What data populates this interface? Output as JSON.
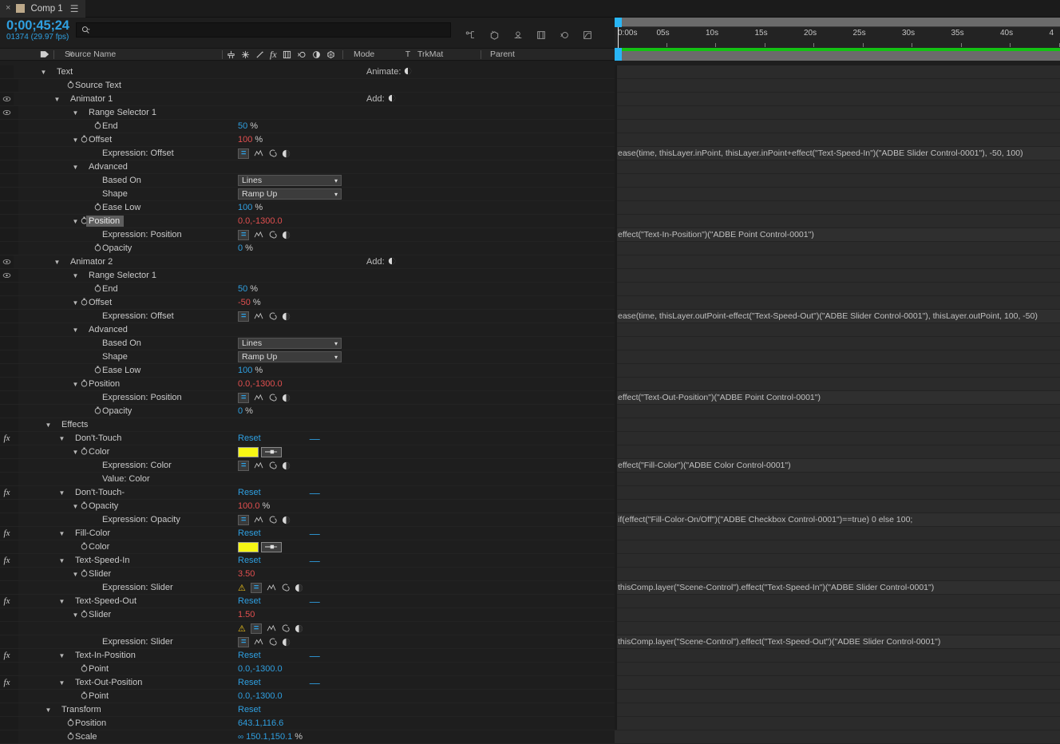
{
  "tab": {
    "close": "×",
    "label": "Comp 1",
    "menu": "☰"
  },
  "timecode": {
    "current": "0;00;45;24",
    "frames": "01374 (29.97 fps)"
  },
  "search": {
    "placeholder": "",
    "value": ""
  },
  "columns": {
    "source_name": "Source Name",
    "number": "#",
    "mode": "Mode",
    "t": "T",
    "trkmat": "TrkMat",
    "parent": "Parent"
  },
  "ruler": {
    "ticks": [
      "0:00s",
      "05s",
      "10s",
      "15s",
      "20s",
      "25s",
      "30s",
      "35s",
      "40s",
      "4"
    ],
    "render_bar_color": "#13c213",
    "playhead_color": "#29b6f6"
  },
  "colors": {
    "accent_blue": "#2f9fe0",
    "value_red": "#e04f4f",
    "swatch_yellow": "#f6f615",
    "warning_yellow": "#f2c61c"
  },
  "rows": [
    {
      "indent": 1,
      "twirl": "▼",
      "label": "Text",
      "kind": "group",
      "add": "Animate:",
      "clipped": true
    },
    {
      "indent": 2,
      "stopwatch": true,
      "label": "Source Text",
      "kind": "prop"
    },
    {
      "indent": 2,
      "twirl": "▼",
      "label": "Animator 1",
      "kind": "group",
      "add": "Add:",
      "eye": true
    },
    {
      "indent": 3,
      "twirl": "▼",
      "label": "Range Selector 1",
      "kind": "group",
      "eye": true
    },
    {
      "indent": 4,
      "stopwatch": true,
      "label": "End",
      "kind": "prop",
      "value": "50",
      "value_color": "blue",
      "unit": "%"
    },
    {
      "indent": 3,
      "twirl": "▼",
      "stopwatch": true,
      "label": "Offset",
      "kind": "prop",
      "value": "100",
      "value_color": "red",
      "unit": "%"
    },
    {
      "indent": 4,
      "label": "Expression: Offset",
      "kind": "expr",
      "expression": "ease(time, thisLayer.inPoint, thisLayer.inPoint+effect(\"Text-Speed-In\")(\"ADBE Slider Control-0001\"), -50, 100)"
    },
    {
      "indent": 3,
      "twirl": "▼",
      "label": "Advanced",
      "kind": "group"
    },
    {
      "indent": 4,
      "label": "Based On",
      "kind": "dropdown",
      "dropdown": "Lines"
    },
    {
      "indent": 4,
      "label": "Shape",
      "kind": "dropdown",
      "dropdown": "Ramp Up"
    },
    {
      "indent": 4,
      "stopwatch": true,
      "label": "Ease Low",
      "kind": "prop",
      "value": "100",
      "value_color": "blue",
      "unit": "%"
    },
    {
      "indent": 3,
      "twirl": "▼",
      "stopwatch": true,
      "label": "Position",
      "kind": "prop",
      "value": "0.0,-1300.0",
      "value_color": "red",
      "selected": true
    },
    {
      "indent": 4,
      "label": "Expression: Position",
      "kind": "expr",
      "expression": "effect(\"Text-In-Position\")(\"ADBE Point Control-0001\")"
    },
    {
      "indent": 4,
      "stopwatch": true,
      "label": "Opacity",
      "kind": "prop",
      "value": "0",
      "value_color": "blue",
      "unit": "%"
    },
    {
      "indent": 2,
      "twirl": "▼",
      "label": "Animator 2",
      "kind": "group",
      "add": "Add:",
      "eye": true
    },
    {
      "indent": 3,
      "twirl": "▼",
      "label": "Range Selector 1",
      "kind": "group",
      "eye": true
    },
    {
      "indent": 4,
      "stopwatch": true,
      "label": "End",
      "kind": "prop",
      "value": "50",
      "value_color": "blue",
      "unit": "%"
    },
    {
      "indent": 3,
      "twirl": "▼",
      "stopwatch": true,
      "label": "Offset",
      "kind": "prop",
      "value": "-50",
      "value_color": "red",
      "unit": "%"
    },
    {
      "indent": 4,
      "label": "Expression: Offset",
      "kind": "expr",
      "expression": "ease(time, thisLayer.outPoint-effect(\"Text-Speed-Out\")(\"ADBE Slider Control-0001\"), thisLayer.outPoint, 100, -50)"
    },
    {
      "indent": 3,
      "twirl": "▼",
      "label": "Advanced",
      "kind": "group"
    },
    {
      "indent": 4,
      "label": "Based On",
      "kind": "dropdown",
      "dropdown": "Lines"
    },
    {
      "indent": 4,
      "label": "Shape",
      "kind": "dropdown",
      "dropdown": "Ramp Up"
    },
    {
      "indent": 4,
      "stopwatch": true,
      "label": "Ease Low",
      "kind": "prop",
      "value": "100",
      "value_color": "blue",
      "unit": "%"
    },
    {
      "indent": 3,
      "twirl": "▼",
      "stopwatch": true,
      "label": "Position",
      "kind": "prop",
      "value": "0.0,-1300.0",
      "value_color": "red"
    },
    {
      "indent": 4,
      "label": "Expression: Position",
      "kind": "expr",
      "expression": "effect(\"Text-Out-Position\")(\"ADBE Point Control-0001\")"
    },
    {
      "indent": 4,
      "stopwatch": true,
      "label": "Opacity",
      "kind": "prop",
      "value": "0",
      "value_color": "blue",
      "unit": "%"
    },
    {
      "indent": 1,
      "twirl": "▼",
      "label": "Effects",
      "kind": "group"
    },
    {
      "indent": 2,
      "twirl": "▼",
      "label": "Don't-Touch",
      "kind": "effect",
      "fx": true,
      "reset": "Reset",
      "minus": "—"
    },
    {
      "indent": 3,
      "twirl": "▼",
      "stopwatch": true,
      "label": "Color",
      "kind": "color",
      "swatch": "#f6f615"
    },
    {
      "indent": 4,
      "label": "Expression: Color",
      "kind": "expr",
      "expression": "effect(\"Fill-Color\")(\"ADBE Color Control-0001\")"
    },
    {
      "indent": 4,
      "label": "Value: Color",
      "kind": "plain"
    },
    {
      "indent": 2,
      "twirl": "▼",
      "label": "Don't-Touch-",
      "kind": "effect",
      "fx": true,
      "reset": "Reset",
      "minus": "—"
    },
    {
      "indent": 3,
      "twirl": "▼",
      "stopwatch": true,
      "label": "Opacity",
      "kind": "prop",
      "value": "100.0",
      "value_color": "red",
      "unit": "%"
    },
    {
      "indent": 4,
      "label": "Expression: Opacity",
      "kind": "expr",
      "expression": "if(effect(\"Fill-Color-On/Off\")(\"ADBE Checkbox Control-0001\")==true) 0 else 100;"
    },
    {
      "indent": 2,
      "twirl": "▼",
      "label": "Fill-Color",
      "kind": "effect",
      "fx": true,
      "reset": "Reset",
      "minus": "—"
    },
    {
      "indent": 3,
      "stopwatch": true,
      "label": "Color",
      "kind": "color",
      "swatch": "#f6f615"
    },
    {
      "indent": 2,
      "twirl": "▼",
      "label": "Text-Speed-In",
      "kind": "effect",
      "fx": true,
      "reset": "Reset",
      "minus": "—"
    },
    {
      "indent": 3,
      "twirl": "▼",
      "stopwatch": true,
      "label": "Slider",
      "kind": "prop",
      "value": "3.50",
      "value_color": "red"
    },
    {
      "indent": 4,
      "label": "Expression: Slider",
      "kind": "expr",
      "warning": true,
      "expression": "thisComp.layer(\"Scene-Control\").effect(\"Text-Speed-In\")(\"ADBE Slider Control-0001\")"
    },
    {
      "indent": 2,
      "twirl": "▼",
      "label": "Text-Speed-Out",
      "kind": "effect",
      "fx": true,
      "reset": "Reset",
      "minus": "—"
    },
    {
      "indent": 3,
      "twirl": "▼",
      "stopwatch": true,
      "label": "Slider",
      "kind": "prop",
      "value": "1.50",
      "value_color": "red"
    },
    {
      "indent": 4,
      "label": "",
      "kind": "exprwarn",
      "warning": true
    },
    {
      "indent": 4,
      "label": "Expression: Slider",
      "kind": "expr",
      "expression": "thisComp.layer(\"Scene-Control\").effect(\"Text-Speed-Out\")(\"ADBE Slider Control-0001\")"
    },
    {
      "indent": 2,
      "twirl": "▼",
      "label": "Text-In-Position",
      "kind": "effect",
      "fx": true,
      "reset": "Reset",
      "minus": "—"
    },
    {
      "indent": 3,
      "stopwatch": true,
      "label": "Point",
      "kind": "prop",
      "value": "0.0,-1300.0",
      "value_color": "blue"
    },
    {
      "indent": 2,
      "twirl": "▼",
      "label": "Text-Out-Position",
      "kind": "effect",
      "fx": true,
      "reset": "Reset",
      "minus": "—"
    },
    {
      "indent": 3,
      "stopwatch": true,
      "label": "Point",
      "kind": "prop",
      "value": "0.0,-1300.0",
      "value_color": "blue"
    },
    {
      "indent": 1,
      "twirl": "▼",
      "label": "Transform",
      "kind": "group",
      "reset": "Reset"
    },
    {
      "indent": 2,
      "stopwatch": true,
      "label": "Position",
      "kind": "prop",
      "value": "643.1,116.6",
      "value_color": "blue"
    },
    {
      "indent": 2,
      "stopwatch": true,
      "label": "Scale",
      "kind": "prop",
      "value": "150.1,150.1",
      "value_color": "blue",
      "unit": "%",
      "chain": true
    }
  ]
}
